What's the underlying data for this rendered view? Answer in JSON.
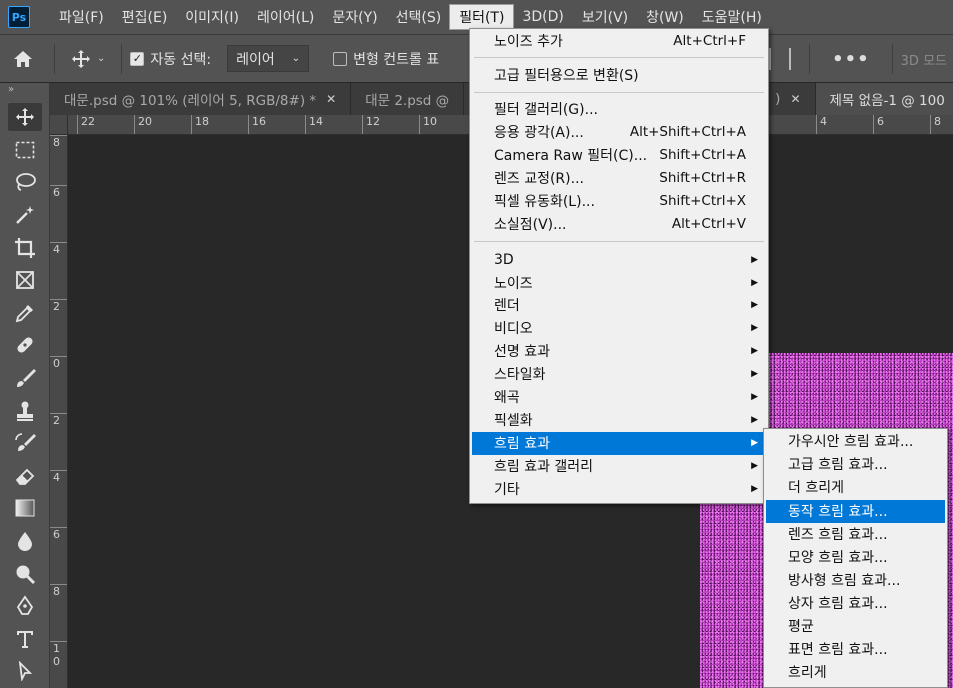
{
  "app": {
    "logo_text": "Ps"
  },
  "menubar": {
    "items": [
      "파일(F)",
      "편집(E)",
      "이미지(I)",
      "레이어(L)",
      "문자(Y)",
      "선택(S)",
      "필터(T)",
      "3D(D)",
      "보기(V)",
      "창(W)",
      "도움말(H)"
    ],
    "active_index": 6
  },
  "options": {
    "auto_select_label": "자동 선택:",
    "auto_select_checked": true,
    "auto_select_value": "레이어",
    "transform_label": "변형 컨트롤 표",
    "transform_checked": false,
    "three_d_label": "3D 모드"
  },
  "tabs": [
    {
      "title": "대문.psd @ 101% (레이어 5, RGB/8#) *",
      "closable": true,
      "active": false
    },
    {
      "title": "대문 2.psd @",
      "closable": false,
      "active": false
    },
    {
      "title": ")",
      "closable": true,
      "active": false
    },
    {
      "title": "제목 없음-1 @ 100",
      "closable": false,
      "active": true
    }
  ],
  "ruler_h": [
    "22",
    "20",
    "18",
    "16",
    "14",
    "12",
    "10",
    "4",
    "6",
    "8"
  ],
  "ruler_v": [
    "8",
    "6",
    "4",
    "2",
    "0",
    "2",
    "4",
    "6",
    "8",
    "1 0"
  ],
  "tools": [
    "move-tool-icon",
    "marquee-tool-icon",
    "lasso-tool-icon",
    "magic-wand-icon",
    "crop-tool-icon",
    "frame-tool-icon",
    "eyedropper-icon",
    "healing-brush-icon",
    "brush-tool-icon",
    "clone-stamp-icon",
    "history-brush-icon",
    "eraser-icon",
    "gradient-tool-icon",
    "blur-tool-icon",
    "dodge-tool-icon",
    "pen-tool-icon",
    "type-tool-icon",
    "path-select-icon"
  ],
  "filter_menu": {
    "group1": [
      {
        "label": "노이즈 추가",
        "shortcut": "Alt+Ctrl+F"
      }
    ],
    "group2": [
      {
        "label": "고급 필터용으로 변환(S)",
        "shortcut": ""
      }
    ],
    "group3": [
      {
        "label": "필터 갤러리(G)...",
        "shortcut": ""
      },
      {
        "label": "응용 광각(A)...",
        "shortcut": "Alt+Shift+Ctrl+A"
      },
      {
        "label": "Camera Raw 필터(C)...",
        "shortcut": "Shift+Ctrl+A"
      },
      {
        "label": "렌즈 교정(R)...",
        "shortcut": "Shift+Ctrl+R"
      },
      {
        "label": "픽셀 유동화(L)...",
        "shortcut": "Shift+Ctrl+X"
      },
      {
        "label": "소실점(V)...",
        "shortcut": "Alt+Ctrl+V"
      }
    ],
    "group4": [
      {
        "label": "3D",
        "submenu": true
      },
      {
        "label": "노이즈",
        "submenu": true
      },
      {
        "label": "렌더",
        "submenu": true
      },
      {
        "label": "비디오",
        "submenu": true
      },
      {
        "label": "선명 효과",
        "submenu": true
      },
      {
        "label": "스타일화",
        "submenu": true
      },
      {
        "label": "왜곡",
        "submenu": true
      },
      {
        "label": "픽셀화",
        "submenu": true
      },
      {
        "label": "흐림 효과",
        "submenu": true,
        "highlighted": true
      },
      {
        "label": "흐림 효과 갤러리",
        "submenu": true
      },
      {
        "label": "기타",
        "submenu": true
      }
    ]
  },
  "blur_submenu": {
    "items": [
      "가우시안 흐림 효과...",
      "고급 흐림 효과...",
      "더 흐리게",
      "동작 흐림 효과...",
      "렌즈 흐림 효과...",
      "모양 흐림 효과...",
      "방사형 흐림 효과...",
      "상자 흐림 효과...",
      "평균",
      "표면 흐림 효과...",
      "흐리게"
    ],
    "highlighted_index": 3
  },
  "colors": {
    "highlight": "#0078d7",
    "panel": "#535353",
    "canvas_bg": "#282828",
    "document_fill": "#c23fc8"
  }
}
